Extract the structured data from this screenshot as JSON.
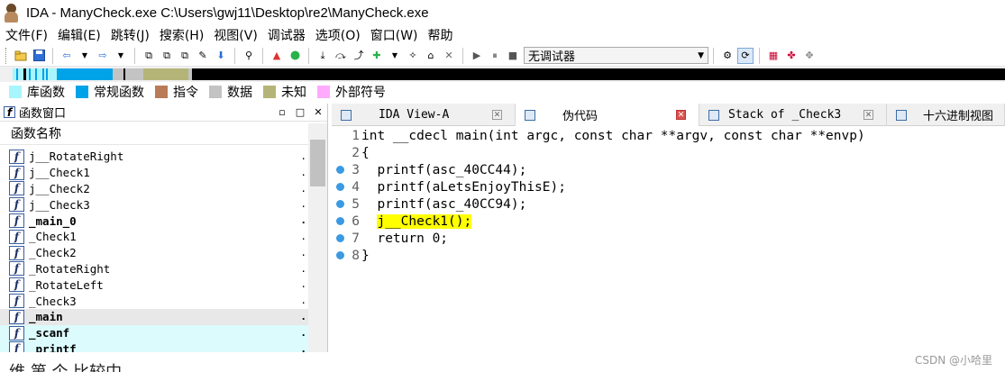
{
  "title": "IDA - ManyCheck.exe C:\\Users\\gwj11\\Desktop\\re2\\ManyCheck.exe",
  "menu": [
    "文件(F)",
    "编辑(E)",
    "跳转(J)",
    "搜索(H)",
    "视图(V)",
    "调试器",
    "选项(O)",
    "窗口(W)",
    "帮助"
  ],
  "toolbar": {
    "debugger_select": "无调试器",
    "icons": [
      "open-icon",
      "save-icon",
      "back-icon",
      "forward-icon",
      "copy-icon",
      "paste-icon",
      "download-icon",
      "graph-icon",
      "run-icon",
      "pause-icon",
      "stop-icon"
    ]
  },
  "legend": [
    {
      "label": "库函数",
      "color": "#a9f5fd"
    },
    {
      "label": "常规函数",
      "color": "#00a2e8"
    },
    {
      "label": "指令",
      "color": "#b97a57"
    },
    {
      "label": "数据",
      "color": "#c3c3c3"
    },
    {
      "label": "未知",
      "color": "#b5b478"
    },
    {
      "label": "外部符号",
      "color": "#ffaaff"
    }
  ],
  "func_window": {
    "title": "函数窗口",
    "column": "函数名称",
    "items": [
      {
        "name": "j__RotateRight",
        "bold": false,
        "sel": false,
        "lib": false
      },
      {
        "name": "j__Check1",
        "bold": false,
        "sel": false,
        "lib": false
      },
      {
        "name": "j__Check2",
        "bold": false,
        "sel": false,
        "lib": false
      },
      {
        "name": "j__Check3",
        "bold": false,
        "sel": false,
        "lib": false
      },
      {
        "name": "_main_0",
        "bold": true,
        "sel": false,
        "lib": false
      },
      {
        "name": "_Check1",
        "bold": false,
        "sel": false,
        "lib": false
      },
      {
        "name": "_Check2",
        "bold": false,
        "sel": false,
        "lib": false
      },
      {
        "name": "_RotateRight",
        "bold": false,
        "sel": false,
        "lib": false
      },
      {
        "name": "_RotateLeft",
        "bold": false,
        "sel": false,
        "lib": false
      },
      {
        "name": "_Check3",
        "bold": false,
        "sel": false,
        "lib": false
      },
      {
        "name": "_main",
        "bold": true,
        "sel": true,
        "lib": false
      },
      {
        "name": "_scanf",
        "bold": true,
        "sel": false,
        "lib": true
      },
      {
        "name": "_printf",
        "bold": true,
        "sel": false,
        "lib": true
      }
    ]
  },
  "tabs": [
    {
      "label": "IDA View-A",
      "active": false
    },
    {
      "label": "伪代码",
      "active": true
    },
    {
      "label": "Stack of _Check3",
      "active": false
    },
    {
      "label": "十六进制视图",
      "active": false
    }
  ],
  "code": [
    {
      "n": "1",
      "bp": false,
      "text": "int __cdecl main(int argc, const char **argv, const char **envp)"
    },
    {
      "n": "2",
      "bp": false,
      "text": "{"
    },
    {
      "n": "3",
      "bp": true,
      "text": "  printf(asc_40CC44);"
    },
    {
      "n": "4",
      "bp": true,
      "text": "  printf(aLetsEnjoyThisE);"
    },
    {
      "n": "5",
      "bp": true,
      "text": "  printf(asc_40CC94);"
    },
    {
      "n": "6",
      "bp": true,
      "text": "  j__Check1();"
    },
    {
      "n": "7",
      "bp": true,
      "text": "  return 0;"
    },
    {
      "n": "8",
      "bp": true,
      "text": "}"
    }
  ],
  "bottom_text": "维                   第       个      比较中",
  "watermark": "CSDN @小哈里"
}
